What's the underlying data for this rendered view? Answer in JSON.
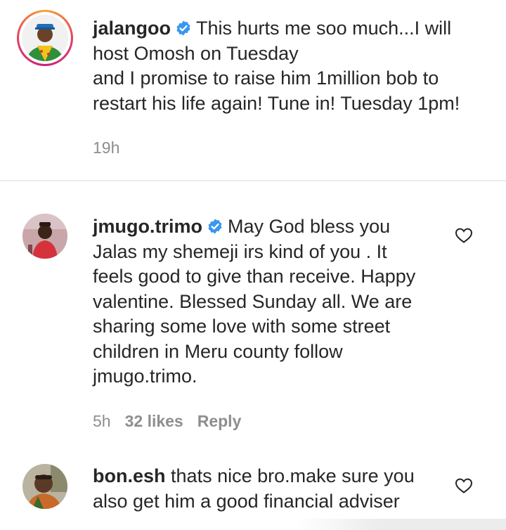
{
  "comments": [
    {
      "username": "jalangoo",
      "verified": true,
      "text": "This hurts me soo much...I will host Omosh on Tuesday and I promise to raise him 1million bob to restart his life again! Tune in! Tuesday 1pm!",
      "lines": [
        "This hurts me soo much...I will",
        "host Omosh on Tuesday",
        "and I promise to raise him 1million bob to",
        "restart his life again! Tune in! Tuesday 1pm!"
      ],
      "time": "19h",
      "has_story_ring": true
    },
    {
      "username": "jmugo.trimo",
      "verified": true,
      "text": "May God bless you Jalas my shemeji irs kind of you . It feels good to give than receive. Happy valentine. Blessed Sunday all. We are sharing some love with some street children in Meru county follow jmugo.trimo.",
      "lines": [
        "May God bless you",
        "Jalas my shemeji irs kind of you . It",
        "feels good to give than receive. Happy",
        "valentine. Blessed Sunday all. We are",
        "sharing some love with some street",
        "children in Meru county follow",
        "jmugo.trimo."
      ],
      "time": "5h",
      "likes": "32 likes",
      "reply": "Reply"
    },
    {
      "username": "bon.esh",
      "verified": false,
      "text": "thats nice bro.make sure you also get him a good financial adviser",
      "lines": [
        "thats nice bro.make sure you",
        "also get him a good financial adviser"
      ]
    }
  ],
  "icons": {
    "verified": "verified-badge-icon",
    "like": "heart-outline-icon"
  },
  "colors": {
    "verified_blue": "#3897f0",
    "muted_text": "#8e8e8e",
    "text": "#262626",
    "story_ring_start": "#f9a334",
    "story_ring_end": "#c8237e"
  }
}
